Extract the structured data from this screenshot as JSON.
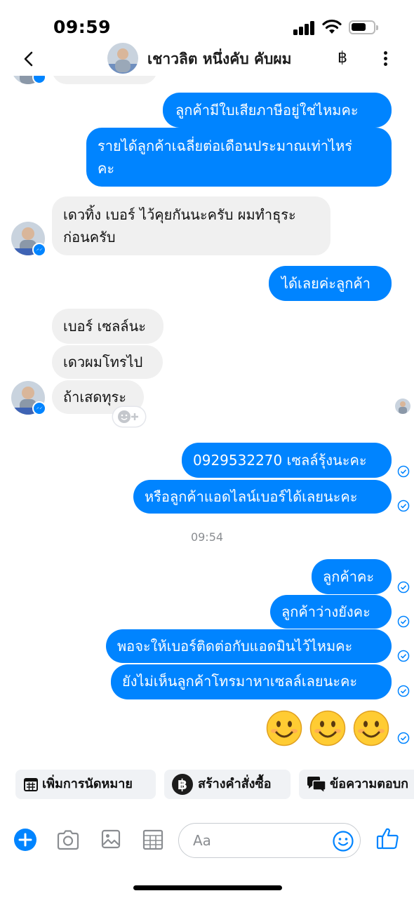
{
  "status_bar": {
    "time": "09:59"
  },
  "header": {
    "contact_name": "เชาวลิต หนึ่งคับ คับผม",
    "baht_symbol": "฿"
  },
  "messages": {
    "m1": "ลูกค้ามีใบเสียภาษีอยู่ใช่ไหมคะ",
    "m2_line1": "รายได้ลูกค้าเฉลี่ยต่อเดือนประมาณเท่าไหร่",
    "m2_line2": "คะ",
    "m3_line1": "เดวทิ้ง เบอร์ ไว้คุยกันนะครับ ผมทำธุระ",
    "m3_line2": "ก่อนครับ",
    "m4": "ได้เลยค่ะลูกค้า",
    "m5": "เบอร์ เซลล์นะ",
    "m6": "เดวผมโทรไป",
    "m7": "ถ้าเสดทุระ",
    "m8": "0929532270 เซลล์รุ้งนะคะ",
    "m9": "หรือลูกค้าแอดไลน์เบอร์ได้เลยนะคะ",
    "timestamp": "09:54",
    "m10": "ลูกค้าคะ",
    "m11": "ลูกค้าว่างยังคะ",
    "m12": "พอจะให้เบอร์ติดต่อกับแอดมินไว้ไหมคะ",
    "m13": "ยังไม่เห็นลูกค้าโทรมาหาเซลล์เลยนะคะ",
    "emoji_count": 3
  },
  "quick_actions": {
    "appointment": "เพิ่มการนัดหมาย",
    "create_order": "สร้างคำสั่งซื้อ",
    "saved_reply": "ข้อความตอบก"
  },
  "composer": {
    "placeholder": "Aa"
  },
  "colors": {
    "accent": "#0084ff",
    "incoming_bubble": "#f0f0f0"
  },
  "icons": [
    "back-icon",
    "baht-icon",
    "more-icon",
    "check-icon",
    "add-icon",
    "camera-icon",
    "gallery-icon",
    "template-icon",
    "emoji-icon",
    "like-icon"
  ]
}
